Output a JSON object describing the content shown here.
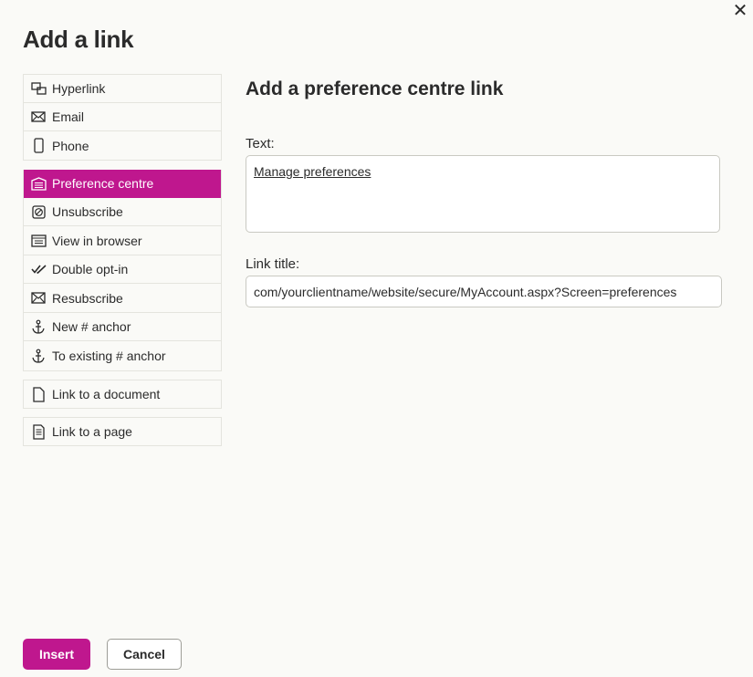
{
  "dialog": {
    "title": "Add a link",
    "close_glyph": "✕"
  },
  "nav": {
    "groups": [
      {
        "items": [
          {
            "label": "Hyperlink",
            "icon": "hyperlink-icon"
          },
          {
            "label": "Email",
            "icon": "email-icon"
          },
          {
            "label": "Phone",
            "icon": "phone-icon"
          }
        ]
      },
      {
        "items": [
          {
            "label": "Preference centre",
            "icon": "preference-centre-icon",
            "active": true
          },
          {
            "label": "Unsubscribe",
            "icon": "unsubscribe-icon"
          },
          {
            "label": "View in browser",
            "icon": "browser-icon"
          },
          {
            "label": "Double opt-in",
            "icon": "double-check-icon"
          },
          {
            "label": "Resubscribe",
            "icon": "resubscribe-icon"
          },
          {
            "label": "New # anchor",
            "icon": "anchor-icon"
          },
          {
            "label": "To existing # anchor",
            "icon": "anchor-icon"
          }
        ]
      },
      {
        "items": [
          {
            "label": "Link to a document",
            "icon": "document-icon"
          }
        ]
      },
      {
        "items": [
          {
            "label": "Link to a page",
            "icon": "page-icon"
          }
        ]
      }
    ]
  },
  "panel": {
    "title": "Add a preference centre link",
    "text_label": "Text:",
    "text_value": "Manage preferences",
    "link_title_label": "Link title:",
    "link_title_value": "com/yourclientname/website/secure/MyAccount.aspx?Screen=preferences"
  },
  "buttons": {
    "insert": "Insert",
    "cancel": "Cancel"
  },
  "colors": {
    "accent": "#bf178e",
    "background": "#fafaf7",
    "border": "#e4e4de"
  }
}
